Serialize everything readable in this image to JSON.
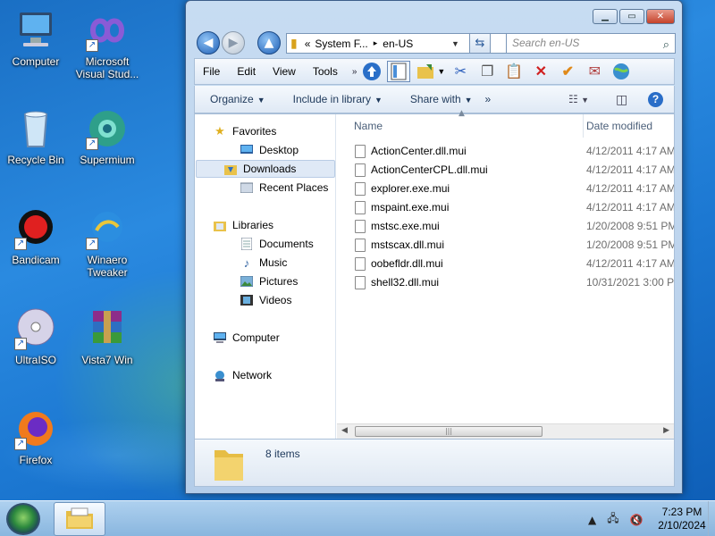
{
  "desktop": {
    "icons": [
      {
        "label": "Computer",
        "icon": "computer-icon"
      },
      {
        "label": "Microsoft Visual Stud...",
        "icon": "visual-studio-icon"
      },
      {
        "label": "Recycle Bin",
        "icon": "recycle-bin-icon"
      },
      {
        "label": "Supermium",
        "icon": "supermium-icon"
      },
      {
        "label": "Bandicam",
        "icon": "bandicam-icon"
      },
      {
        "label": "Winaero Tweaker",
        "icon": "winaero-icon"
      },
      {
        "label": "UltraISO",
        "icon": "ultraiso-icon"
      },
      {
        "label": "Vista7 Win",
        "icon": "winrar-icon"
      },
      {
        "label": "Firefox",
        "icon": "firefox-icon"
      }
    ]
  },
  "window": {
    "address": {
      "prefix": "«",
      "crumb1": "System F...",
      "sep": "▸",
      "crumb2": "en-US"
    },
    "search_placeholder": "Search en-US",
    "menu": [
      "File",
      "Edit",
      "View",
      "Tools"
    ],
    "commands": {
      "organize": "Organize",
      "include": "Include in library",
      "share": "Share with",
      "more": "»"
    },
    "nav": {
      "favorites": "Favorites",
      "desktop": "Desktop",
      "downloads": "Downloads",
      "recent": "Recent Places",
      "libraries": "Libraries",
      "documents": "Documents",
      "music": "Music",
      "pictures": "Pictures",
      "videos": "Videos",
      "computer": "Computer",
      "network": "Network"
    },
    "columns": {
      "name": "Name",
      "date": "Date modified"
    },
    "files": [
      {
        "name": "ActionCenter.dll.mui",
        "date": "4/12/2011 4:17 AM"
      },
      {
        "name": "ActionCenterCPL.dll.mui",
        "date": "4/12/2011 4:17 AM"
      },
      {
        "name": "explorer.exe.mui",
        "date": "4/12/2011 4:17 AM"
      },
      {
        "name": "mspaint.exe.mui",
        "date": "4/12/2011 4:17 AM"
      },
      {
        "name": "mstsc.exe.mui",
        "date": "1/20/2008 9:51 PM"
      },
      {
        "name": "mstscax.dll.mui",
        "date": "1/20/2008 9:51 PM"
      },
      {
        "name": "oobefldr.dll.mui",
        "date": "4/12/2011 4:17 AM"
      },
      {
        "name": "shell32.dll.mui",
        "date": "10/31/2021 3:00 PM"
      }
    ],
    "status": {
      "count": "8 items"
    }
  },
  "taskbar": {
    "clock_time": "7:23 PM",
    "clock_date": "2/10/2024"
  },
  "colors": {
    "accent": "#1f5fb5",
    "wallpaper": "#1c78d2"
  }
}
